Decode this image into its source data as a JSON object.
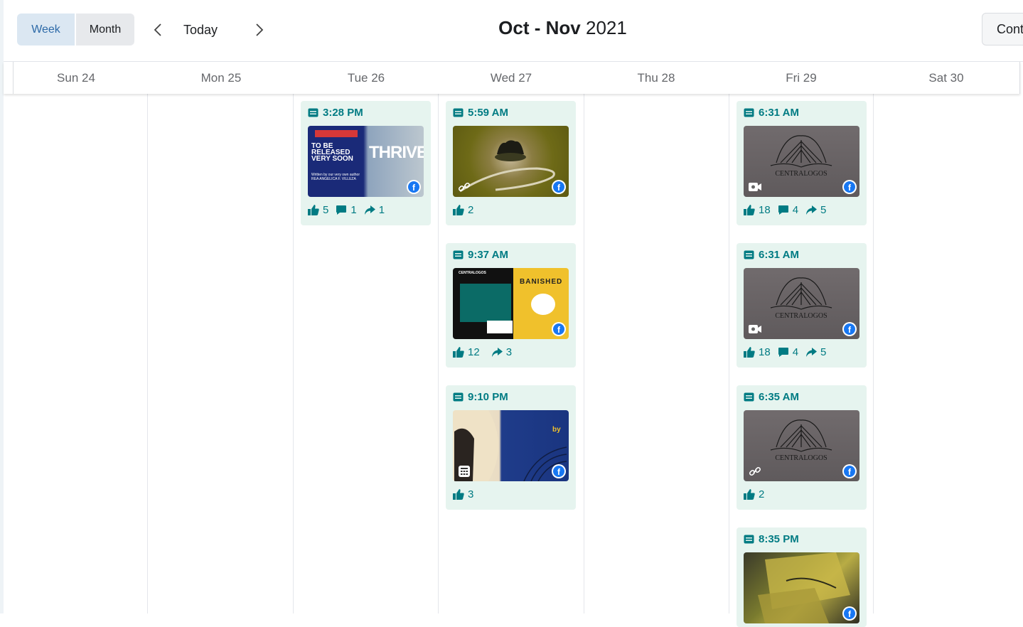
{
  "toolbar": {
    "week_label": "Week",
    "month_label": "Month",
    "today_label": "Today",
    "title_range": "Oct - Nov",
    "title_year": "2021",
    "content_button_label": "Cont"
  },
  "days": [
    "Sun 24",
    "Mon 25",
    "Tue 26",
    "Wed 27",
    "Thu 28",
    "Fri 29",
    "Sat 30"
  ],
  "posts": {
    "tue_1": {
      "time": "3:28 PM",
      "likes": "5",
      "comments": "1",
      "shares": "1",
      "thumb_big": "THRIVE",
      "thumb_headline": "TO BE RELEASED VERY SOON",
      "thumb_small": "Written by our very own author REA ANGELICA F. VILLEZA"
    },
    "wed_1": {
      "time": "5:59 AM",
      "likes": "2",
      "media_type": "link-icon"
    },
    "wed_2": {
      "time": "9:37 AM",
      "likes": "12",
      "shares": "3",
      "thumb_brand": "CENTRALOGOS",
      "thumb_title": "BANISHED"
    },
    "wed_3": {
      "time": "9:10 PM",
      "likes": "3",
      "media_type": "carousel-icon",
      "thumb_word": "by"
    },
    "fri_1": {
      "time": "6:31 AM",
      "likes": "18",
      "comments": "4",
      "shares": "5",
      "media_type": "video-icon"
    },
    "fri_2": {
      "time": "6:31 AM",
      "likes": "18",
      "comments": "4",
      "shares": "5",
      "media_type": "video-icon"
    },
    "fri_3": {
      "time": "6:35 AM",
      "likes": "2",
      "media_type": "link-icon"
    },
    "fri_4": {
      "time": "8:35 PM"
    }
  },
  "logo_text": "CENTRALOGOS",
  "colors": {
    "accent": "#007b83",
    "card_bg": "#e6f4ef",
    "week_selected": "#dbe7f2",
    "facebook": "#1877f2"
  }
}
